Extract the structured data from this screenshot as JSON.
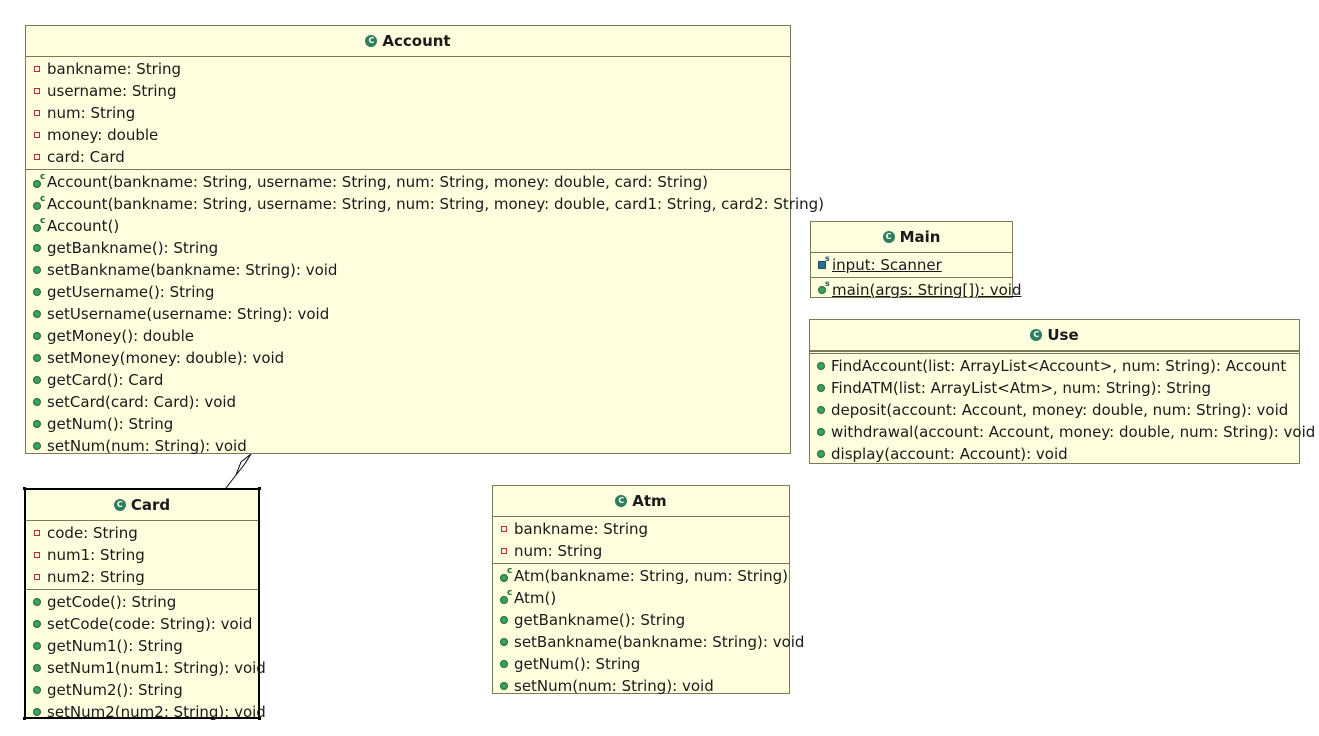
{
  "classes": {
    "account": {
      "name": "Account",
      "attributes": [
        "bankname: String",
        "username: String",
        "num: String",
        "money: double",
        "card: Card"
      ],
      "constructors": [
        "Account(bankname: String, username: String, num: String, money: double, card: String)",
        "Account(bankname: String, username: String, num: String, money: double, card1: String, card2: String)",
        "Account()"
      ],
      "methods": [
        "getBankname(): String",
        "setBankname(bankname: String): void",
        "getUsername(): String",
        "setUsername(username: String): void",
        "getMoney(): double",
        "setMoney(money: double): void",
        "getCard(): Card",
        "setCard(card: Card): void",
        "getNum(): String",
        "setNum(num: String): void"
      ]
    },
    "main": {
      "name": "Main",
      "attributes": [
        "input: Scanner"
      ],
      "methods": [
        "main(args: String[]): void"
      ]
    },
    "use": {
      "name": "Use",
      "methods": [
        "FindAccount(list: ArrayList<Account>, num: String): Account",
        "FindATM(list: ArrayList<Atm>, num: String): String",
        "deposit(account: Account, money: double, num: String): void",
        "withdrawal(account: Account, money: double, num: String): void",
        "display(account: Account): void"
      ]
    },
    "card": {
      "name": "Card",
      "attributes": [
        "code: String",
        "num1: String",
        "num2: String"
      ],
      "methods": [
        "getCode(): String",
        "setCode(code: String): void",
        "getNum1(): String",
        "setNum1(num1: String): void",
        "getNum2(): String",
        "setNum2(num2: String): void"
      ]
    },
    "atm": {
      "name": "Atm",
      "attributes": [
        "bankname: String",
        "num: String"
      ],
      "constructors": [
        "Atm(bankname: String, num: String)",
        "Atm()"
      ],
      "methods": [
        "getBankname(): String",
        "setBankname(bankname: String): void",
        "getNum(): String",
        "setNum(num: String): void"
      ]
    }
  },
  "colors": {
    "class_fill": "#ffffe0",
    "class_border": "#7a7a54",
    "public_icon": "#3aa15b",
    "private_icon": "#b33030"
  },
  "icons": {
    "class_header": "class-c-icon",
    "private_field": "private-field-icon",
    "public_method": "public-method-icon",
    "constructor": "constructor-icon",
    "static_field": "static-field-icon",
    "static_method": "static-method-icon"
  }
}
